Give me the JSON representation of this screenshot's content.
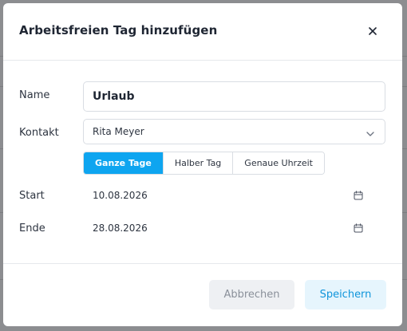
{
  "dialog": {
    "title": "Arbeitsfreien Tag hinzufügen",
    "close_icon": "close-icon"
  },
  "form": {
    "name_label": "Name",
    "name_value": "Urlaub",
    "contact_label": "Kontakt",
    "contact_value": "Rita Meyer",
    "duration_options": [
      {
        "label": "Ganze Tage",
        "selected": true
      },
      {
        "label": "Halber Tag",
        "selected": false
      },
      {
        "label": "Genaue Uhrzeit",
        "selected": false
      }
    ],
    "start_label": "Start",
    "start_value": "10.08.2026",
    "end_label": "Ende",
    "end_value": "28.08.2026"
  },
  "footer": {
    "cancel_label": "Abbrechen",
    "save_label": "Speichern"
  },
  "colors": {
    "accent": "#0ea5f0",
    "save_text": "#0f95db",
    "save_bg": "#e6f5fd",
    "cancel_bg": "#eef0f3",
    "cancel_text": "#8a909a",
    "backdrop": "#8c8d90"
  }
}
